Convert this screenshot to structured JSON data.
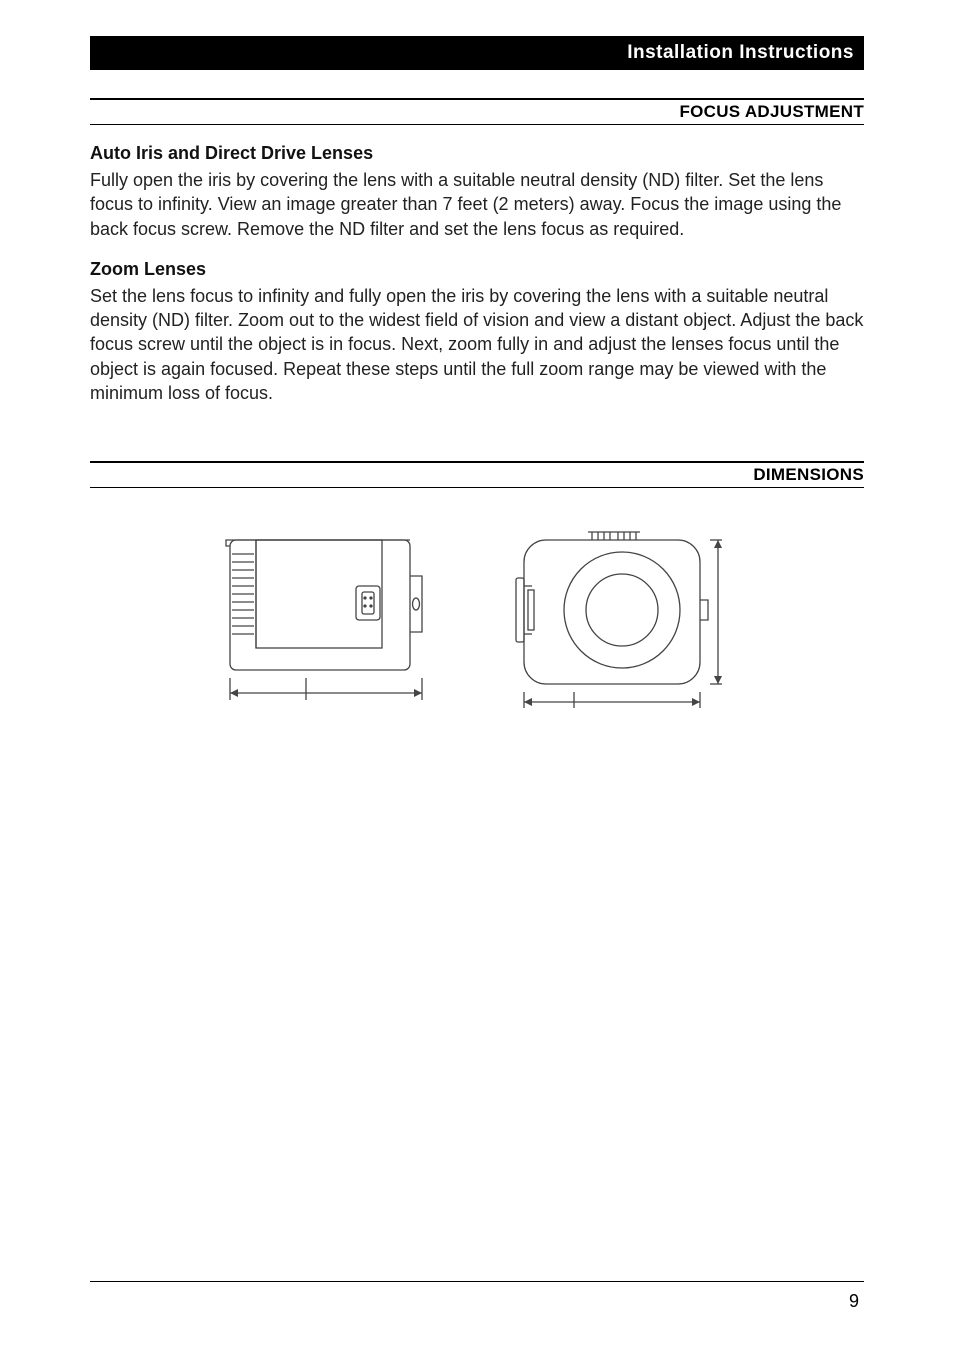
{
  "header": {
    "title": "Installation  Instructions"
  },
  "section1": {
    "title": "FOCUS ADJUSTMENT",
    "sub1": {
      "heading": "Auto Iris and Direct Drive Lenses",
      "text": "Fully open the iris by covering the lens with a suitable neutral density (ND) filter. Set the lens focus to infinity. View an image greater than 7 feet (2 meters) away. Focus the image using the back focus screw. Remove the ND filter and set the lens focus as required."
    },
    "sub2": {
      "heading": "Zoom  Lenses",
      "text": "Set the lens focus to infinity and fully open the iris by covering the lens with a suitable neutral density (ND) filter. Zoom out to the widest field of vision and view a distant object. Adjust the back focus screw until the object is in focus. Next, zoom fully in and adjust the lenses focus until the object is again focused. Repeat these steps until the full zoom range may be viewed with the minimum loss of focus."
    }
  },
  "section2": {
    "title": "DIMENSIONS"
  },
  "pageNumber": "9"
}
